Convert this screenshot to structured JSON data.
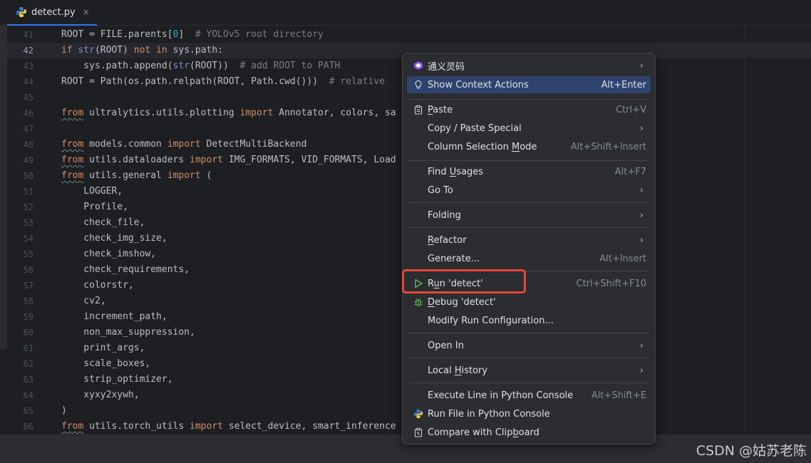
{
  "tab": {
    "filename": "detect.py",
    "close": "×"
  },
  "lines": [
    {
      "num": "41",
      "parts": [
        [
          "",
          "ROOT = FILE.parents["
        ],
        [
          "num",
          "0"
        ],
        [
          "",
          "]  "
        ],
        [
          "cm",
          "# YOLOv5 root directory"
        ]
      ]
    },
    {
      "num": "42",
      "current": true,
      "parts": [
        [
          "kw",
          "if "
        ],
        [
          "bi",
          "str"
        ],
        [
          "",
          "(ROOT) "
        ],
        [
          "kw",
          "not in "
        ],
        [
          "",
          "sys.path:"
        ]
      ]
    },
    {
      "num": "43",
      "parts": [
        [
          "",
          "    sys.path.append("
        ],
        [
          "bi",
          "str"
        ],
        [
          "",
          "(ROOT))  "
        ],
        [
          "cm",
          "# add ROOT to PATH"
        ]
      ]
    },
    {
      "num": "44",
      "parts": [
        [
          "",
          "ROOT = Path(os.path.relpath(ROOT, Path.cwd()))  "
        ],
        [
          "cm",
          "# relative"
        ]
      ]
    },
    {
      "num": "45",
      "parts": []
    },
    {
      "num": "46",
      "parts": [
        [
          "kwsq",
          "from"
        ],
        [
          "",
          " ultralytics.utils.plotting "
        ],
        [
          "kw",
          "import"
        ],
        [
          "",
          " Annotator, colors, sa"
        ]
      ]
    },
    {
      "num": "47",
      "parts": []
    },
    {
      "num": "48",
      "parts": [
        [
          "kwsq",
          "from"
        ],
        [
          "",
          " models.common "
        ],
        [
          "kw",
          "import"
        ],
        [
          "",
          " DetectMultiBackend"
        ]
      ]
    },
    {
      "num": "49",
      "parts": [
        [
          "kwsq",
          "from"
        ],
        [
          "",
          " utils.dataloaders "
        ],
        [
          "kw",
          "import"
        ],
        [
          "",
          " IMG_FORMATS, VID_FORMATS, Load"
        ]
      ]
    },
    {
      "num": "50",
      "parts": [
        [
          "kwsq",
          "from"
        ],
        [
          "",
          " utils.general "
        ],
        [
          "kw",
          "import"
        ],
        [
          "",
          " ("
        ]
      ]
    },
    {
      "num": "51",
      "parts": [
        [
          "",
          "    LOGGER,"
        ]
      ]
    },
    {
      "num": "52",
      "parts": [
        [
          "",
          "    Profile,"
        ]
      ]
    },
    {
      "num": "53",
      "parts": [
        [
          "",
          "    check_file,"
        ]
      ]
    },
    {
      "num": "54",
      "parts": [
        [
          "",
          "    check_img_size,"
        ]
      ]
    },
    {
      "num": "55",
      "parts": [
        [
          "",
          "    check_imshow,"
        ]
      ]
    },
    {
      "num": "56",
      "parts": [
        [
          "",
          "    check_requirements,"
        ]
      ]
    },
    {
      "num": "57",
      "parts": [
        [
          "",
          "    colorstr,"
        ]
      ]
    },
    {
      "num": "58",
      "parts": [
        [
          "",
          "    cv2,"
        ]
      ]
    },
    {
      "num": "59",
      "parts": [
        [
          "",
          "    increment_path,"
        ]
      ]
    },
    {
      "num": "60",
      "parts": [
        [
          "",
          "    non_max_suppression,"
        ]
      ]
    },
    {
      "num": "61",
      "parts": [
        [
          "",
          "    print_args,"
        ]
      ]
    },
    {
      "num": "62",
      "parts": [
        [
          "",
          "    scale_boxes,"
        ]
      ]
    },
    {
      "num": "63",
      "parts": [
        [
          "",
          "    strip_optimizer,"
        ]
      ]
    },
    {
      "num": "64",
      "parts": [
        [
          "",
          "    xyxy2xywh,"
        ]
      ]
    },
    {
      "num": "65",
      "parts": [
        [
          "",
          ")"
        ]
      ]
    },
    {
      "num": "66",
      "parts": [
        [
          "kwsq",
          "from"
        ],
        [
          "",
          " utils.torch_utils "
        ],
        [
          "kw",
          "import"
        ],
        [
          "",
          " select_device, smart_inference"
        ]
      ]
    }
  ],
  "menu": {
    "tongyi": "通义灵码",
    "show_context_actions": "Show Context Actions",
    "show_context_actions_sc": "Alt+Enter",
    "paste_u": "P",
    "paste_rest": "aste",
    "paste_sc": "Ctrl+V",
    "copy_paste_special": "Copy / Paste Special",
    "column_selection_a": "Column Selection ",
    "column_selection_u": "M",
    "column_selection_b": "ode",
    "column_selection_sc": "Alt+Shift+Insert",
    "find_usages_a": "Find ",
    "find_usages_u": "U",
    "find_usages_b": "sages",
    "find_usages_sc": "Alt+F7",
    "go_to": "Go To",
    "folding": "Folding",
    "refactor_u": "R",
    "refactor_rest": "efactor",
    "generate": "Generate...",
    "generate_sc": "Alt+Insert",
    "run_a": "R",
    "run_u": "u",
    "run_b": "n 'detect'",
    "run_sc": "Ctrl+Shift+F10",
    "debug_u": "D",
    "debug_rest": "ebug 'detect'",
    "modify_run": "Modify Run Configuration...",
    "open_in": "Open In",
    "local_history_a": "Local ",
    "local_history_u": "H",
    "local_history_b": "istory",
    "execute_line": "Execute Line in Python Console",
    "execute_line_sc": "Alt+Shift+E",
    "run_file_console": "Run File in Python Console",
    "compare_a": "Compare with Clip",
    "compare_u": "b",
    "compare_b": "oard",
    "arrow": "›"
  },
  "watermark": "CSDN @姑苏老陈",
  "colors": {
    "highlight": "#2e436e",
    "annotation_box": "#e8453c",
    "run_icon": "#5fb865",
    "debug_icon": "#5fb865"
  }
}
